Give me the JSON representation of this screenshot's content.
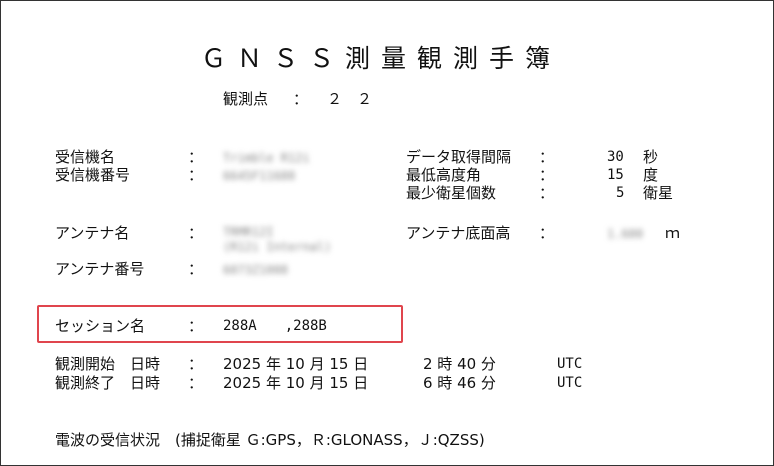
{
  "title": "ＧＮＳＳ測量観測手簿",
  "point": {
    "label": "観測点",
    "sep": "：",
    "value": "２　２"
  },
  "receiver": {
    "name_label": "受信機名",
    "name_value": "Trimble R12i",
    "serial_label": "受信機番号",
    "serial_value": "6645F11688"
  },
  "antenna": {
    "name_label": "アンテナ名",
    "name_value_1": "TRMR12I",
    "name_value_2": "(R12i Internal)",
    "serial_label": "アンテナ番号",
    "serial_value": "6073Z1008",
    "height_label": "アンテナ底面高",
    "height_value": "1.600",
    "height_unit": "ｍ"
  },
  "settings": {
    "interval_label": "データ取得間隔",
    "interval_value": "30",
    "interval_unit": "秒",
    "mask_label": "最低高度角",
    "mask_value": "15",
    "mask_unit": "度",
    "sats_label": "最少衛星個数",
    "sats_value": "5",
    "sats_unit": "衛星"
  },
  "session": {
    "label": "セッション名",
    "value": "288A　　,288B"
  },
  "observation": {
    "start_label": "観測開始　日時",
    "start_date": "2025 年 10 月 15 日",
    "start_time": "2 時 40 分",
    "end_label": "観測終了　日時",
    "end_date": "2025 年 10 月 15 日",
    "end_time": "6 時 46 分",
    "tz": "UTC"
  },
  "signal": {
    "label": "電波の受信状況　(捕捉衛星 Ｇ:GPS，Ｒ:GLONASS，Ｊ:QZSS)"
  },
  "colon": "："
}
